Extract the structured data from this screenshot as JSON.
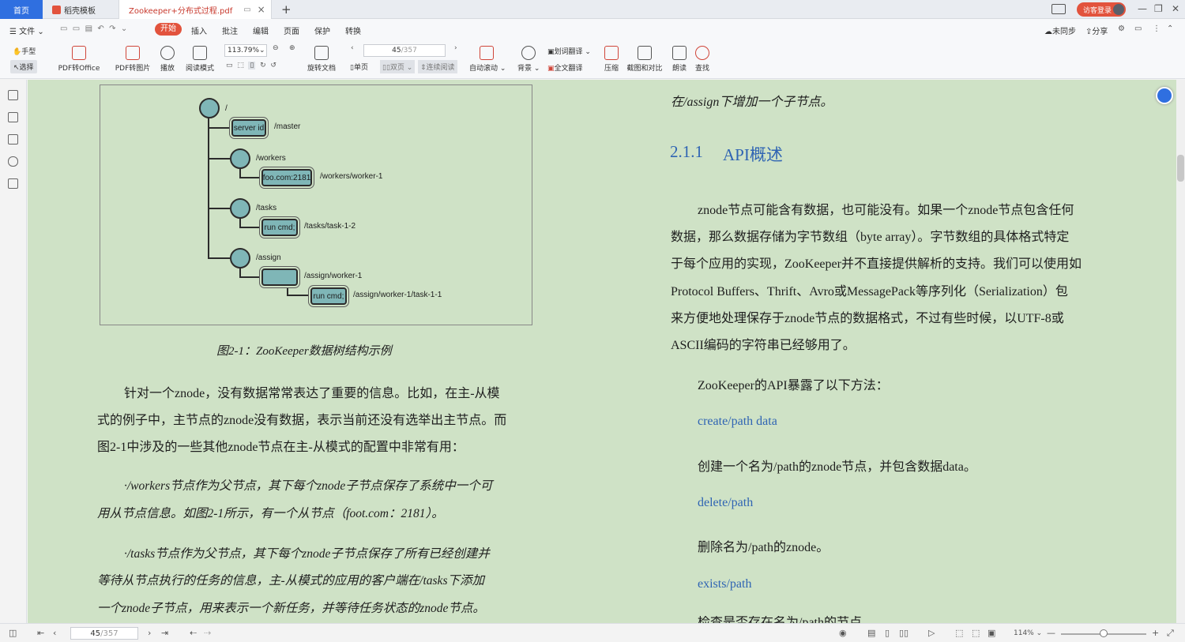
{
  "tabs": {
    "home": "首页",
    "template": "稻壳模板",
    "pdf": "Zookeeper+分布式过程.pdf",
    "close": "×",
    "new": "+"
  },
  "window": {
    "login": "访客登录",
    "minimize": "—",
    "restore": "❐",
    "close": "✕"
  },
  "menu": {
    "file": "文件",
    "items": [
      "开始",
      "插入",
      "批注",
      "编辑",
      "页面",
      "保护",
      "转换"
    ],
    "right": {
      "sync": "未同步",
      "share": "分享"
    }
  },
  "toolbar": {
    "hand": "手型",
    "select": "选择",
    "pdf_to_office": "PDF转Office",
    "pdf_to_image": "PDF转图片",
    "play": "播放",
    "read_mode": "阅读模式",
    "zoom": "113.79%",
    "rotate": "旋转文档",
    "page_current": "45",
    "page_total": "/357",
    "single": "单页",
    "double": "双页",
    "continuous": "连续阅读",
    "auto_scroll": "自动滚动",
    "background": "背景",
    "word_translate": "划词翻译",
    "full_translate": "全文翻译",
    "compress": "压缩",
    "screenshot_compare": "截图和对比",
    "read_aloud": "朗读",
    "find": "查找"
  },
  "diagram": {
    "root": "/",
    "master_box": "server id",
    "master_label": "/master",
    "workers_label": "/workers",
    "worker_box": "foo.com:2181",
    "worker_label": "/workers/worker-1",
    "tasks_label": "/tasks",
    "task_box": "run cmd;",
    "task_label": "/tasks/task-1-2",
    "assign_label": "/assign",
    "assign_worker_box": "",
    "assign_worker_label": "/assign/worker-1",
    "assign_task_box": "run cmd;",
    "assign_task_label": "/assign/worker-1/task-1-1"
  },
  "left_page": {
    "caption": "图2-1：ZooKeeper数据树结构示例",
    "p1": [
      "针对一个znode，没有数据常常表达了重要的信息。比如，在主-从模",
      "式的例子中，主节点的znode没有数据，表示当前还没有选举出主节点。而",
      "图2-1中涉及的一些其他znode节点在主-从模式的配置中非常有用："
    ],
    "p2": [
      "·/workers节点作为父节点，其下每个znode子节点保存了系统中一个可",
      "用从节点信息。如图2-1所示，有一个从节点（foot.com：2181）。"
    ],
    "p3": [
      "·/tasks节点作为父节点，其下每个znode子节点保存了所有已经创建并",
      "等待从节点执行的任务的信息，主-从模式的应用的客户端在/tasks下添加",
      "一个znode子节点，用来表示一个新任务，并等待任务状态的znode节点。"
    ]
  },
  "right_page": {
    "top": "在/assign下增加一个子节点。",
    "heading_num": "2.1.1",
    "heading": "API概述",
    "p1": [
      "znode节点可能含有数据，也可能没有。如果一个znode节点包含任何",
      "数据，那么数据存储为字节数组（byte array）。字节数组的具体格式特定",
      "于每个应用的实现，ZooKeeper并不直接提供解析的支持。我们可以使用如",
      "Protocol Buffers、Thrift、Avro或MessagePack等序列化（Serialization）包",
      "来方便地处理保存于znode节点的数据格式，不过有些时候，以UTF-8或",
      "ASCII编码的字符串已经够用了。"
    ],
    "p2": "ZooKeeper的API暴露了以下方法：",
    "m1": "create/path data",
    "m1_desc": "创建一个名为/path的znode节点，并包含数据data。",
    "m2": "delete/path",
    "m2_desc": "删除名为/path的znode。",
    "m3": "exists/path",
    "m3_desc": "检查是否存在名为/path的节点。"
  },
  "statusbar": {
    "page_current": "45",
    "page_total": "/357",
    "zoom": "114%"
  },
  "colors": {
    "accent": "#2f6fe0",
    "brand_red": "#e2533d",
    "page_bg": "#cfe2c6",
    "link": "#2f64b3"
  }
}
